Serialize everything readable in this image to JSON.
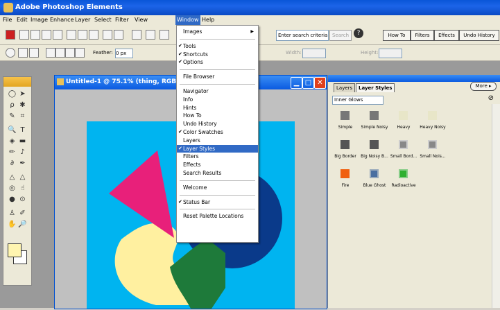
{
  "app_title": "Adobe Photoshop Elements",
  "menu": [
    "File",
    "Edit",
    "Image",
    "Enhance",
    "Layer",
    "Select",
    "Filter",
    "View",
    "Window",
    "Help"
  ],
  "toolbar": {
    "search_placeholder": "Enter search criteria",
    "search_button": "Search",
    "help_icon": "?",
    "tabs": [
      "How To",
      "Filters",
      "Effects",
      "Undo History"
    ]
  },
  "options_bar": {
    "feather_label": "Feather:",
    "feather_value": "0 px",
    "width_label": "Width:",
    "height_label": "Height:"
  },
  "document": {
    "title": "Untitled-1 @ 75.1% (thing, RGB)"
  },
  "window_menu": [
    {
      "label": "Images",
      "checked": false,
      "submenu": true
    },
    {
      "sep": true
    },
    {
      "label": "Tools",
      "checked": true
    },
    {
      "label": "Shortcuts",
      "checked": true
    },
    {
      "label": "Options",
      "checked": true
    },
    {
      "sep": true
    },
    {
      "label": "File Browser",
      "checked": false
    },
    {
      "sep": true
    },
    {
      "label": "Navigator",
      "checked": false
    },
    {
      "label": "Info",
      "checked": false
    },
    {
      "label": "Hints",
      "checked": false
    },
    {
      "label": "How To",
      "checked": false
    },
    {
      "label": "Undo History",
      "checked": false
    },
    {
      "label": "Color Swatches",
      "checked": true
    },
    {
      "label": "Layers",
      "checked": false
    },
    {
      "label": "Layer Styles",
      "checked": true,
      "selected": true
    },
    {
      "label": "Filters",
      "checked": false
    },
    {
      "label": "Effects",
      "checked": false
    },
    {
      "label": "Search Results",
      "checked": false
    },
    {
      "sep": true
    },
    {
      "label": "Welcome",
      "checked": false
    },
    {
      "sep": true
    },
    {
      "label": "Status Bar",
      "checked": true
    },
    {
      "sep": true
    },
    {
      "label": "Reset Palette Locations",
      "checked": false
    }
  ],
  "palette": {
    "tabs": [
      "Layers",
      "Layer Styles"
    ],
    "more_button": "More ▸",
    "category": "Inner Glows",
    "styles": [
      {
        "label": "Simple",
        "color": "#777777"
      },
      {
        "label": "Simple Noisy",
        "color": "#777777"
      },
      {
        "label": "Heavy",
        "color": "#e8e6c8"
      },
      {
        "label": "Heavy Noisy",
        "color": "#e8e6c8"
      },
      {
        "label": "Big Border",
        "color": "#555555"
      },
      {
        "label": "Big Noisy B...",
        "color": "#555555"
      },
      {
        "label": "Small Bord...",
        "color": "#888888"
      },
      {
        "label": "Small Nois...",
        "color": "#888888"
      },
      {
        "label": "Fire",
        "color": "#f06010"
      },
      {
        "label": "Blue Ghost",
        "color": "#4a6fa0"
      },
      {
        "label": "Radioactive",
        "color": "#30b030"
      }
    ]
  },
  "colors": {
    "canvas_bg": "#00b4f0",
    "triangle": "#e8207a",
    "circle": "#0a3a8a",
    "blob": "#fff0a0",
    "green": "#1e7a3a",
    "highlight": "#316ac5"
  }
}
